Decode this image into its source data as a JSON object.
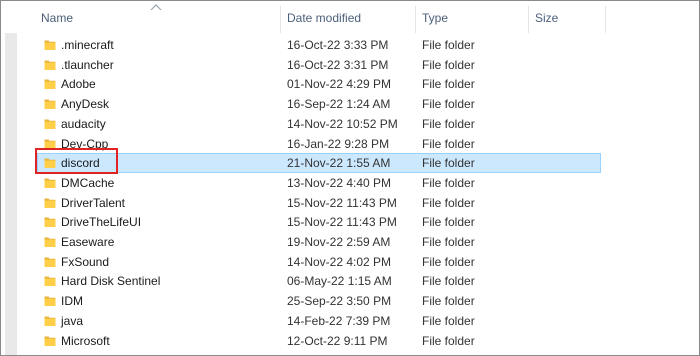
{
  "columns": {
    "name": "Name",
    "date_modified": "Date modified",
    "type": "Type",
    "size": "Size"
  },
  "rows": [
    {
      "name": ".minecraft",
      "date": "16-Oct-22 3:33 PM",
      "type": "File folder"
    },
    {
      "name": ".tlauncher",
      "date": "16-Oct-22 3:31 PM",
      "type": "File folder"
    },
    {
      "name": "Adobe",
      "date": "01-Nov-22 4:29 PM",
      "type": "File folder"
    },
    {
      "name": "AnyDesk",
      "date": "16-Sep-22 1:24 AM",
      "type": "File folder"
    },
    {
      "name": "audacity",
      "date": "14-Nov-22 10:52 PM",
      "type": "File folder"
    },
    {
      "name": "Dev-Cpp",
      "date": "16-Jan-22 9:28 PM",
      "type": "File folder"
    },
    {
      "name": "discord",
      "date": "21-Nov-22 1:55 AM",
      "type": "File folder",
      "selected": true
    },
    {
      "name": "DMCache",
      "date": "13-Nov-22 4:40 PM",
      "type": "File folder"
    },
    {
      "name": "DriverTalent",
      "date": "15-Nov-22 11:43 PM",
      "type": "File folder"
    },
    {
      "name": "DriveTheLifeUI",
      "date": "15-Nov-22 11:43 PM",
      "type": "File folder"
    },
    {
      "name": "Easeware",
      "date": "19-Nov-22 2:59 AM",
      "type": "File folder"
    },
    {
      "name": "FxSound",
      "date": "14-Nov-22 4:02 PM",
      "type": "File folder"
    },
    {
      "name": "Hard Disk Sentinel",
      "date": "06-May-22 1:15 AM",
      "type": "File folder"
    },
    {
      "name": "IDM",
      "date": "25-Sep-22 3:50 PM",
      "type": "File folder"
    },
    {
      "name": "java",
      "date": "14-Feb-22 7:39 PM",
      "type": "File folder"
    },
    {
      "name": "Microsoft",
      "date": "12-Oct-22 9:11 PM",
      "type": "File folder"
    }
  ],
  "colors": {
    "selection_bg": "#cce8ff",
    "selection_border": "#99d1ff",
    "folder_yellow": "#ffcf49",
    "annotation_red": "#e02424"
  },
  "icons": {
    "folder": "folder-icon",
    "sort": "sort-ascending-caret-icon"
  }
}
